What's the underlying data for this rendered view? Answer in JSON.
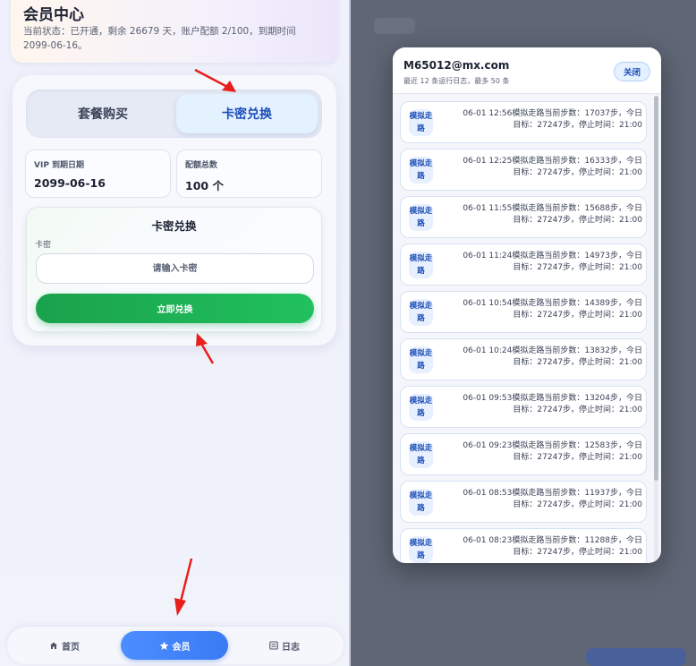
{
  "member": {
    "title": "会员中心",
    "status": "当前状态：已开通，剩余 26679 天，账户配额 2/100，到期时间 2099-06-16。"
  },
  "tabs": [
    {
      "label": "套餐购买",
      "active": false
    },
    {
      "label": "卡密兑换",
      "active": true
    }
  ],
  "stats": [
    {
      "label": "VIP 到期日期",
      "value": "2099-06-16"
    },
    {
      "label": "配额总数",
      "value": "100 个"
    }
  ],
  "redeem": {
    "title": "卡密兑换",
    "field_label": "卡密",
    "placeholder": "请输入卡密",
    "value": "",
    "button": "立即兑换"
  },
  "bottom_nav": [
    {
      "label": "首页",
      "icon": "home-icon",
      "active": false
    },
    {
      "label": "会员",
      "icon": "star-icon",
      "active": true
    },
    {
      "label": "日志",
      "icon": "list-icon",
      "active": false
    }
  ],
  "modal": {
    "title": "M65012@mx.com",
    "subtitle": "最近 12 条运行日志，最多 50 条",
    "close": "关闭",
    "logs": [
      {
        "tag": "模拟走路",
        "line1": "06-01 12:56模拟走路当前步数：17037步，今日",
        "line2": "目标：27247步，停止时间：21:00"
      },
      {
        "tag": "模拟走路",
        "line1": "06-01 12:25模拟走路当前步数：16333步，今日",
        "line2": "目标：27247步，停止时间：21:00"
      },
      {
        "tag": "模拟走路",
        "line1": "06-01 11:55模拟走路当前步数：15688步，今日",
        "line2": "目标：27247步，停止时间：21:00"
      },
      {
        "tag": "模拟走路",
        "line1": "06-01 11:24模拟走路当前步数：14973步，今日",
        "line2": "目标：27247步，停止时间：21:00"
      },
      {
        "tag": "模拟走路",
        "line1": "06-01 10:54模拟走路当前步数：14389步，今日",
        "line2": "目标：27247步，停止时间：21:00"
      },
      {
        "tag": "模拟走路",
        "line1": "06-01 10:24模拟走路当前步数：13832步，今日",
        "line2": "目标：27247步，停止时间：21:00"
      },
      {
        "tag": "模拟走路",
        "line1": "06-01 09:53模拟走路当前步数：13204步，今日",
        "line2": "目标：27247步，停止时间：21:00"
      },
      {
        "tag": "模拟走路",
        "line1": "06-01 09:23模拟走路当前步数：12583步，今日",
        "line2": "目标：27247步，停止时间：21:00"
      },
      {
        "tag": "模拟走路",
        "line1": "06-01 08:53模拟走路当前步数：11937步，今日",
        "line2": "目标：27247步，停止时间：21:00"
      },
      {
        "tag": "模拟走路",
        "line1": "06-01 08:23模拟走路当前步数：11288步，今日",
        "line2": "目标：27247步，停止时间：21:00"
      }
    ]
  },
  "colors": {
    "accent_blue": "#3a7af4",
    "accent_green": "#21c15e",
    "annotation_red": "#e8201c"
  }
}
